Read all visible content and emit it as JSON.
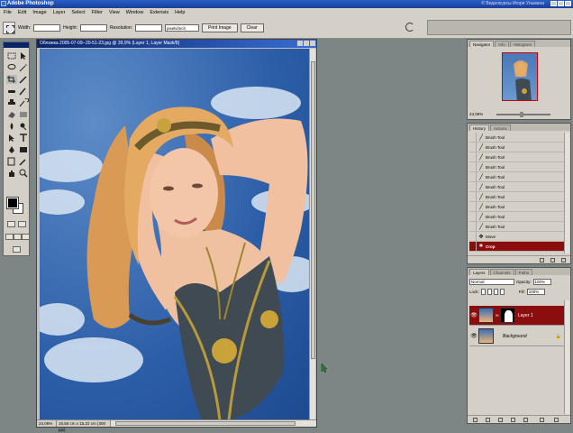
{
  "app": {
    "title": "Adobe Photoshop",
    "watermark": "© Видеокурсы Игоря Ульмана"
  },
  "menu": [
    "File",
    "Edit",
    "Image",
    "Layer",
    "Select",
    "Filter",
    "View",
    "Window",
    "Extensis",
    "Help"
  ],
  "options": {
    "width_label": "Width:",
    "height_label": "Height:",
    "resolution_label": "Resolution:",
    "resolution_unit": "pixels/inch",
    "print_image": "Print Image",
    "clear": "Clear"
  },
  "document": {
    "title": "Обложка 2005-07-09--20-51-23.jpg @ 39,9% (Layer 1, Layer Mask/8)",
    "zoom": "24,06%",
    "info": "15,56 cm x 15,22 cm (300 ppi)"
  },
  "navigator": {
    "tabs": [
      "Navigator",
      "Info",
      "Histogram"
    ],
    "zoom": "24,06%"
  },
  "history": {
    "tabs": [
      "History",
      "Actions"
    ],
    "items": [
      {
        "label": "Brush Tool",
        "icon": "brush-icon"
      },
      {
        "label": "Brush Tool",
        "icon": "brush-icon"
      },
      {
        "label": "Brush Tool",
        "icon": "brush-icon"
      },
      {
        "label": "Brush Tool",
        "icon": "brush-icon"
      },
      {
        "label": "Brush Tool",
        "icon": "brush-icon"
      },
      {
        "label": "Brush Tool",
        "icon": "brush-icon"
      },
      {
        "label": "Brush Tool",
        "icon": "brush-icon"
      },
      {
        "label": "Brush Tool",
        "icon": "brush-icon"
      },
      {
        "label": "Brush Tool",
        "icon": "brush-icon"
      },
      {
        "label": "Brush Tool",
        "icon": "brush-icon"
      },
      {
        "label": "Move",
        "icon": "move-icon"
      },
      {
        "label": "Crop",
        "icon": "crop-icon",
        "active": true
      }
    ]
  },
  "layers": {
    "tabs": [
      "Layers",
      "Channels",
      "Paths"
    ],
    "blend_mode": "Normal",
    "opacity_label": "Opacity:",
    "opacity": "100%",
    "lock_label": "Lock:",
    "fill_label": "Fill:",
    "fill": "100%",
    "items": [
      {
        "name": "Layer 1",
        "active": true
      },
      {
        "name": "Background",
        "active": false
      }
    ]
  },
  "colors": {
    "selection": "#8b0d0d",
    "panel": "#d4d0c8",
    "workspace": "#7d8585"
  }
}
